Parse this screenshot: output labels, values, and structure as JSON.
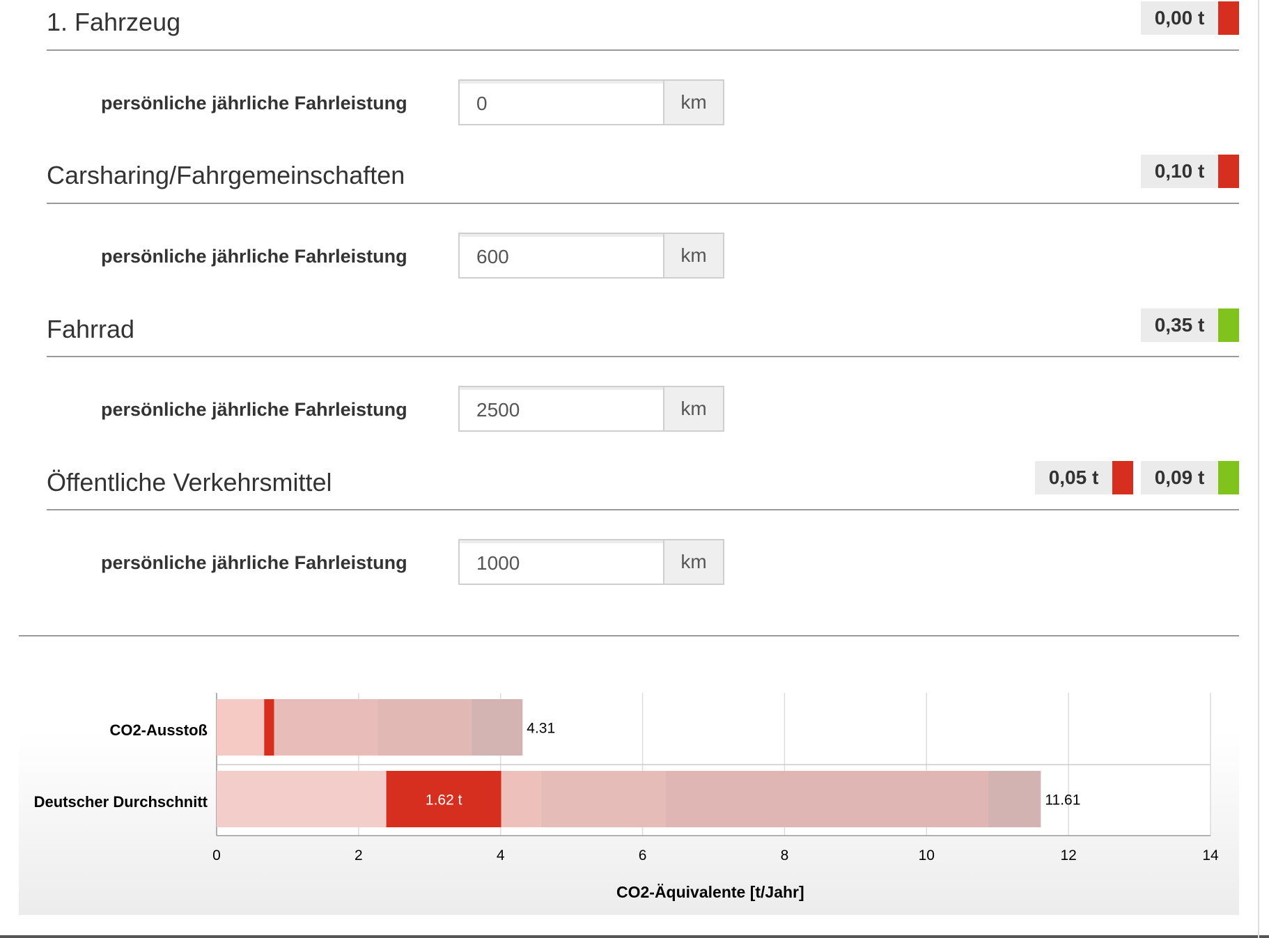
{
  "colors": {
    "red": "#d62f1f",
    "green": "#7fc31c"
  },
  "sections": [
    {
      "title": "1. Fahrzeug",
      "field_label": "persönliche jährliche Fahrleistung",
      "value": "0",
      "unit": "km",
      "badges": [
        {
          "text": "0,00 t",
          "color": "red"
        }
      ]
    },
    {
      "title": "Carsharing/Fahrgemeinschaften",
      "field_label": "persönliche jährliche Fahrleistung",
      "value": "600",
      "unit": "km",
      "badges": [
        {
          "text": "0,10 t",
          "color": "red"
        }
      ]
    },
    {
      "title": "Fahrrad",
      "field_label": "persönliche jährliche Fahrleistung",
      "value": "2500",
      "unit": "km",
      "badges": [
        {
          "text": "0,35 t",
          "color": "green"
        }
      ]
    },
    {
      "title": "Öffentliche Verkehrsmittel",
      "field_label": "persönliche jährliche Fahrleistung",
      "value": "1000",
      "unit": "km",
      "badges": [
        {
          "text": "0,05 t",
          "color": "red"
        },
        {
          "text": "0,09 t",
          "color": "green"
        }
      ]
    }
  ],
  "chart_data": {
    "type": "bar",
    "orientation": "horizontal",
    "stacked": true,
    "categories": [
      "CO2-Ausstoß",
      "Deutscher Durchschnitt"
    ],
    "totals": [
      "4.31",
      "11.61"
    ],
    "segments": [
      [
        {
          "value": 0.67,
          "color": "#f5cac5"
        },
        {
          "value": 0.14,
          "color": "#d62f1f"
        },
        {
          "value": 1.45,
          "color": "#e8bcb8"
        },
        {
          "value": 1.33,
          "color": "#e2b8b5"
        },
        {
          "value": 0.72,
          "color": "#d4b3b3"
        }
      ],
      [
        {
          "value": 2.39,
          "color": "#f3cdc9"
        },
        {
          "value": 1.62,
          "color": "#d62f1f",
          "label": "1.62 t"
        },
        {
          "value": 0.56,
          "color": "#edc0bc"
        },
        {
          "value": 1.75,
          "color": "#e6bcb9"
        },
        {
          "value": 4.55,
          "color": "#dfb6b4"
        },
        {
          "value": 0.74,
          "color": "#d3b2b2"
        }
      ]
    ],
    "xlim": [
      0,
      14
    ],
    "xticks": [
      0,
      2,
      4,
      6,
      8,
      10,
      12,
      14
    ],
    "xlabel": "CO2-Äquivalente [t/Jahr]",
    "grid": true
  }
}
